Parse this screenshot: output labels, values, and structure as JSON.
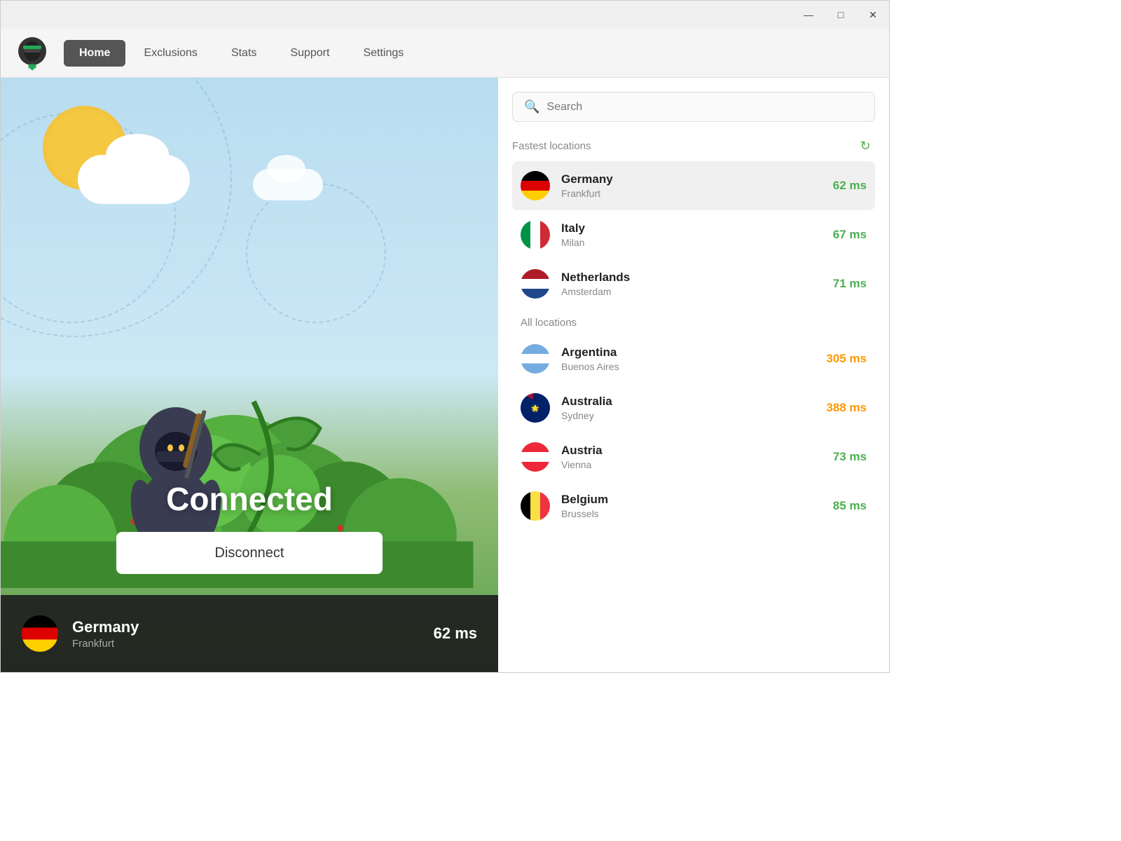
{
  "titlebar": {
    "minimize_label": "—",
    "maximize_label": "□",
    "close_label": "✕"
  },
  "navbar": {
    "logo_alt": "VPN Ninja Logo",
    "items": [
      {
        "id": "home",
        "label": "Home",
        "active": true
      },
      {
        "id": "exclusions",
        "label": "Exclusions",
        "active": false
      },
      {
        "id": "stats",
        "label": "Stats",
        "active": false
      },
      {
        "id": "support",
        "label": "Support",
        "active": false
      },
      {
        "id": "settings",
        "label": "Settings",
        "active": false
      }
    ]
  },
  "main": {
    "status": "Connected",
    "disconnect_label": "Disconnect",
    "connection": {
      "country": "Germany",
      "city": "Frankfurt",
      "latency": "62 ms",
      "flag_emoji": "🇩🇪"
    }
  },
  "sidebar": {
    "search_placeholder": "Search",
    "refresh_icon": "↻",
    "fastest_label": "Fastest locations",
    "all_label": "All locations",
    "fastest_locations": [
      {
        "id": "germany",
        "country": "Germany",
        "city": "Frankfurt",
        "latency": "62 ms",
        "latency_color": "green",
        "flag_emoji": "🇩🇪",
        "selected": true
      },
      {
        "id": "italy",
        "country": "Italy",
        "city": "Milan",
        "latency": "67 ms",
        "latency_color": "green",
        "flag_emoji": "🇮🇹",
        "selected": false
      },
      {
        "id": "netherlands",
        "country": "Netherlands",
        "city": "Amsterdam",
        "latency": "71 ms",
        "latency_color": "green",
        "flag_emoji": "🇳🇱",
        "selected": false
      }
    ],
    "all_locations": [
      {
        "id": "argentina",
        "country": "Argentina",
        "city": "Buenos Aires",
        "latency": "305 ms",
        "latency_color": "orange",
        "flag_emoji": "🇦🇷"
      },
      {
        "id": "australia",
        "country": "Australia",
        "city": "Sydney",
        "latency": "388 ms",
        "latency_color": "orange",
        "flag_emoji": "🇦🇺"
      },
      {
        "id": "austria",
        "country": "Austria",
        "city": "Vienna",
        "latency": "73 ms",
        "latency_color": "green",
        "flag_emoji": "🇦🇹"
      },
      {
        "id": "belgium",
        "country": "Belgium",
        "city": "Brussels",
        "latency": "85 ms",
        "latency_color": "green",
        "flag_emoji": "🇧🇪"
      }
    ]
  }
}
